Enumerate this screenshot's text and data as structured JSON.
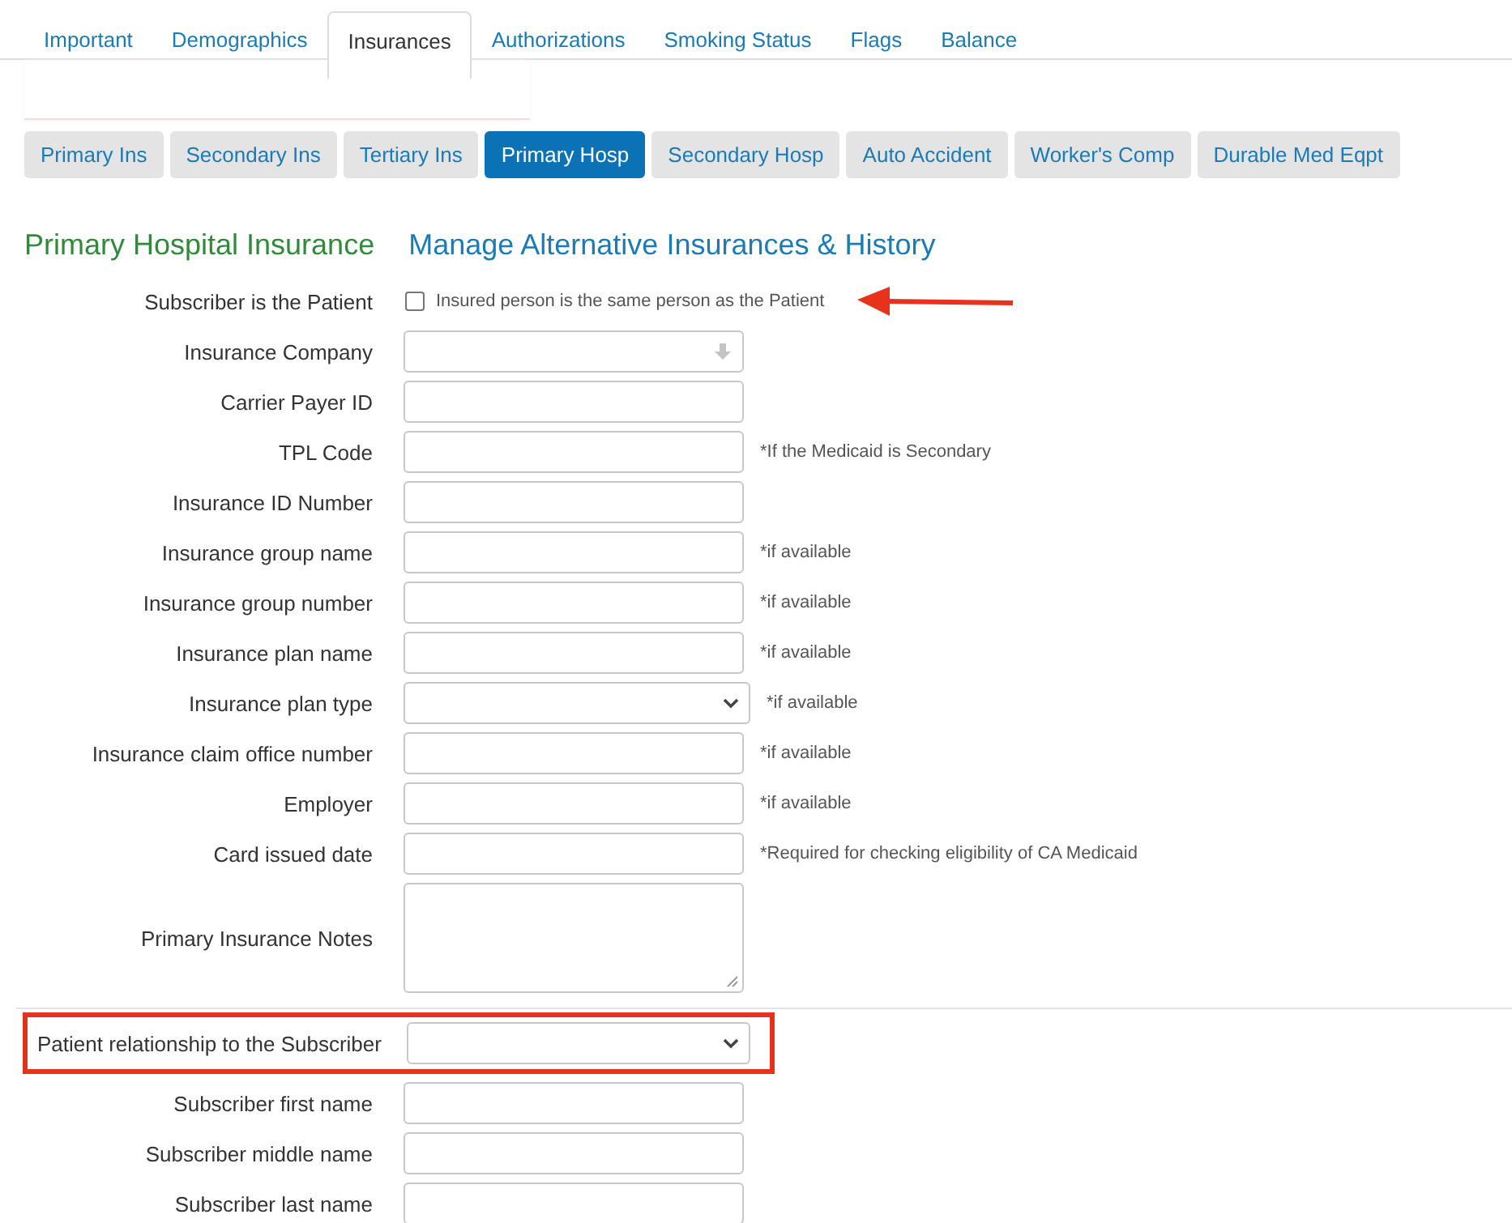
{
  "tabs": [
    {
      "label": "Important",
      "selected": false
    },
    {
      "label": "Demographics",
      "selected": false
    },
    {
      "label": "Insurances",
      "selected": true
    },
    {
      "label": "Authorizations",
      "selected": false
    },
    {
      "label": "Smoking Status",
      "selected": false
    },
    {
      "label": "Flags",
      "selected": false
    },
    {
      "label": "Balance",
      "selected": false
    }
  ],
  "subtabs": [
    {
      "label": "Primary Ins",
      "selected": false
    },
    {
      "label": "Secondary Ins",
      "selected": false
    },
    {
      "label": "Tertiary Ins",
      "selected": false
    },
    {
      "label": "Primary Hosp",
      "selected": true
    },
    {
      "label": "Secondary Hosp",
      "selected": false
    },
    {
      "label": "Auto Accident",
      "selected": false
    },
    {
      "label": "Worker's Comp",
      "selected": false
    },
    {
      "label": "Durable Med Eqpt",
      "selected": false
    }
  ],
  "heading": "Primary Hospital Insurance",
  "manage_link": "Manage Alternative Insurances & History",
  "rows": [
    {
      "kind": "checkbox",
      "label": "Subscriber is the Patient",
      "checkbox_label": "Insured person is the same person as the Patient",
      "checked": false,
      "arrow": true
    },
    {
      "kind": "combo",
      "label": "Insurance Company"
    },
    {
      "kind": "text",
      "label": "Carrier Payer ID"
    },
    {
      "kind": "text",
      "label": "TPL Code",
      "hint": "*If the Medicaid is Secondary"
    },
    {
      "kind": "text",
      "label": "Insurance ID Number"
    },
    {
      "kind": "text",
      "label": "Insurance group name",
      "hint": "*if available"
    },
    {
      "kind": "text",
      "label": "Insurance group number",
      "hint": "*if available"
    },
    {
      "kind": "text",
      "label": "Insurance plan name",
      "hint": "*if available"
    },
    {
      "kind": "select",
      "label": "Insurance plan type",
      "hint": "*if available"
    },
    {
      "kind": "text",
      "label": "Insurance claim office number",
      "hint": "*if available"
    },
    {
      "kind": "text",
      "label": "Employer",
      "hint": "*if available"
    },
    {
      "kind": "text",
      "label": "Card issued date",
      "hint": "*Required for checking eligibility of CA Medicaid"
    },
    {
      "kind": "textarea",
      "label": "Primary Insurance Notes"
    },
    {
      "kind": "select",
      "label": "Patient relationship to the Subscriber",
      "highlighted": true,
      "divider": true
    },
    {
      "kind": "text",
      "label": "Subscriber first name"
    },
    {
      "kind": "text",
      "label": "Subscriber middle name"
    },
    {
      "kind": "text",
      "label": "Subscriber last name"
    }
  ]
}
